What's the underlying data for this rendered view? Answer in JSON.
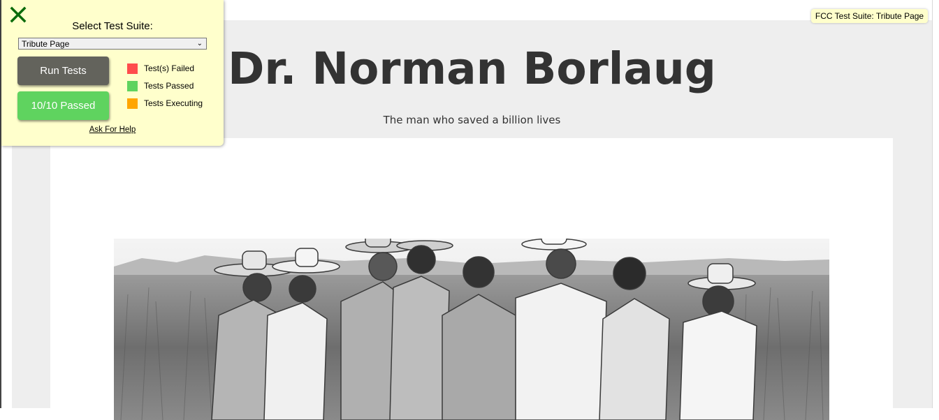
{
  "fcc": {
    "select_label": "Select Test Suite:",
    "selected_suite": "Tribute Page",
    "run_tests_label": "Run Tests",
    "passed_label": "10/10 Passed",
    "legend": [
      {
        "label": "Test(s) Failed",
        "color": "#ff4c4c"
      },
      {
        "label": "Tests Passed",
        "color": "#5fd35f"
      },
      {
        "label": "Tests Executing",
        "color": "#ffa500"
      }
    ],
    "help_link": "Ask For Help",
    "tooltip": "FCC Test Suite: Tribute Page",
    "close_icon": "close-icon"
  },
  "page": {
    "title": "Dr. Norman Borlaug",
    "subtitle": "The man who saved a billion lives"
  },
  "colors": {
    "panel_bg": "#ffffcc",
    "page_bg": "#eeeeee",
    "text": "#333333",
    "run_button": "#63635c",
    "passed_button": "#5fd35f"
  }
}
